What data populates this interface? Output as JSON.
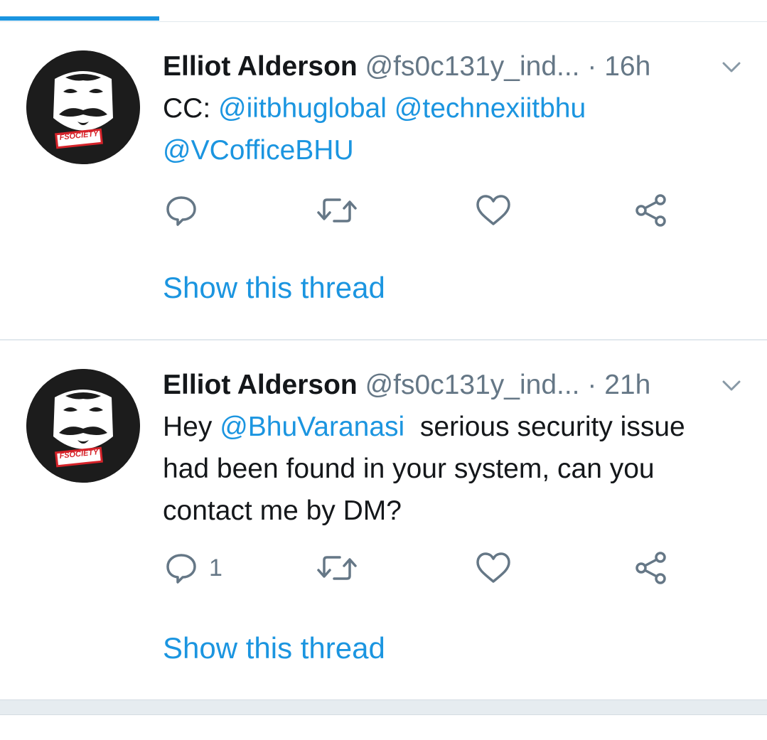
{
  "tweets": [
    {
      "author_name": "Elliot Alderson",
      "handle": "@fs0c131y_ind...",
      "separator": " · ",
      "time": "16h",
      "avatar_label": "FSOCIETY",
      "body": [
        {
          "text": "CC: ",
          "mention": false
        },
        {
          "text": "@iitbhuglobal",
          "mention": true
        },
        {
          "text": " ",
          "mention": false
        },
        {
          "text": "@technexiitbhu",
          "mention": true
        },
        {
          "text": " ",
          "mention": false
        },
        {
          "text": "@VCofficeBHU",
          "mention": true
        }
      ],
      "reply_count": "",
      "show_thread": "Show this thread"
    },
    {
      "author_name": "Elliot Alderson",
      "handle": "@fs0c131y_ind...",
      "separator": " · ",
      "time": "21h",
      "avatar_label": "FSOCIETY",
      "body": [
        {
          "text": "Hey ",
          "mention": false
        },
        {
          "text": "@BhuVaranasi",
          "mention": true
        },
        {
          "text": "  serious security issue had been found in your system, can you contact me by DM?",
          "mention": false
        }
      ],
      "reply_count": "1",
      "show_thread": "Show this thread"
    }
  ],
  "icons": {
    "reply": "reply-icon",
    "retweet": "retweet-icon",
    "like": "heart-icon",
    "share": "share-icon",
    "menu": "chevron-down-icon"
  },
  "colors": {
    "accent": "#1b95e0",
    "text": "#14171a",
    "secondary": "#657786",
    "icon": "#657786",
    "divider": "#e1e8ed"
  }
}
